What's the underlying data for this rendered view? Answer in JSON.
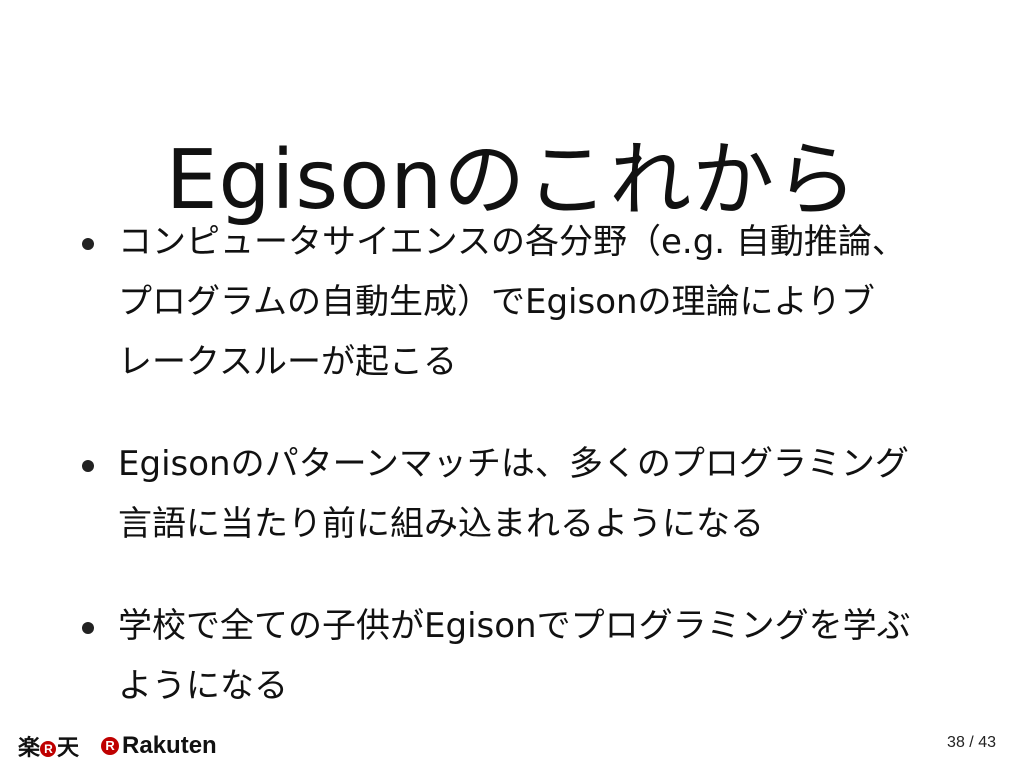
{
  "slide": {
    "title": "Egisonのこれから",
    "bullets": [
      {
        "lines": [
          "コンピュータサイエンスの各分野（e.g. 自動推論、",
          "プログラムの自動生成）でEgisonの理論によりブ",
          "レークスルーが起こる"
        ]
      },
      {
        "lines": [
          "Egisonのパターンマッチは、多くのプログラミング",
          "言語に当たり前に組み込まれるようになる"
        ]
      },
      {
        "lines": [
          "学校で全ての子供がEgisonでプログラミングを学ぶ",
          "ようになる"
        ]
      }
    ]
  },
  "footer": {
    "logo_jp_left": "楽",
    "logo_jp_circle": "R",
    "logo_jp_right": "天",
    "logo_mark_circle": "R",
    "logo_en": "Rakuten",
    "page_current": "38",
    "page_separator": "/",
    "page_total": "43"
  },
  "colors": {
    "brand_red": "#bf0000",
    "text": "#111111",
    "background": "#ffffff"
  }
}
